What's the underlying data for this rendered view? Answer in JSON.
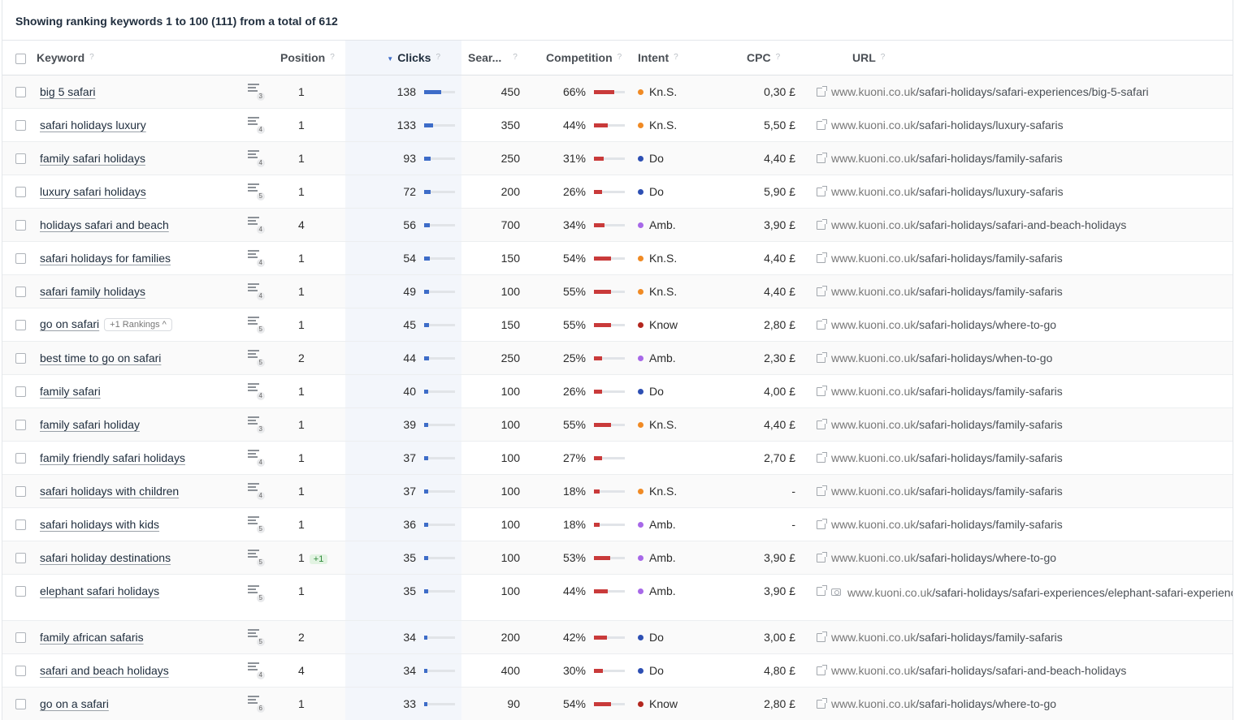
{
  "summary": {
    "prefix": "Showing ranking keywords 1 to 100 (111) from a total of",
    "total": "612"
  },
  "help_glyph": "?",
  "columns": {
    "keyword": "Keyword",
    "position": "Position",
    "clicks": "Clicks",
    "search": "Sear...",
    "competition": "Competition",
    "intent": "Intent",
    "cpc": "CPC",
    "url": "URL"
  },
  "colors": {
    "intent_orange": "#f08a24",
    "intent_blue": "#2d4fb3",
    "intent_purple": "#a768e8",
    "intent_red": "#b3261e",
    "click_bar": "#3d6cc8",
    "competition_bar": "#c93a3a"
  },
  "icons": {
    "serp": "serp-features-icon",
    "external": "external-link-icon",
    "camera": "screenshot-icon",
    "eye": "eye-icon",
    "chart": "chart-icon"
  },
  "rows": [
    {
      "keyword": "big 5 safari",
      "serp": "3",
      "position": "1",
      "clicks": "138",
      "clicks_frac": 0.55,
      "search": "450",
      "competition": "66%",
      "competition_frac": 0.66,
      "intent": "Kn.S.",
      "intent_color": "#f08a24",
      "cpc": "0,30 £",
      "domain": "www.kuoni.co.uk",
      "path": "/safari-holidays/safari-experiences/big-5-safari"
    },
    {
      "keyword": "safari holidays luxury",
      "serp": "4",
      "position": "1",
      "clicks": "133",
      "clicks_frac": 0.3,
      "search": "350",
      "competition": "44%",
      "competition_frac": 0.44,
      "intent": "Kn.S.",
      "intent_color": "#f08a24",
      "cpc": "5,50 £",
      "domain": "www.kuoni.co.uk",
      "path": "/safari-holidays/luxury-safaris"
    },
    {
      "keyword": "family safari holidays",
      "serp": "4",
      "position": "1",
      "clicks": "93",
      "clicks_frac": 0.22,
      "search": "250",
      "competition": "31%",
      "competition_frac": 0.31,
      "intent": "Do",
      "intent_color": "#2d4fb3",
      "cpc": "4,40 £",
      "domain": "www.kuoni.co.uk",
      "path": "/safari-holidays/family-safaris"
    },
    {
      "keyword": "luxury safari holidays",
      "serp": "5",
      "position": "1",
      "clicks": "72",
      "clicks_frac": 0.2,
      "search": "200",
      "competition": "26%",
      "competition_frac": 0.26,
      "intent": "Do",
      "intent_color": "#2d4fb3",
      "cpc": "5,90 £",
      "domain": "www.kuoni.co.uk",
      "path": "/safari-holidays/luxury-safaris"
    },
    {
      "keyword": "holidays safari and beach",
      "serp": "4",
      "position": "4",
      "clicks": "56",
      "clicks_frac": 0.18,
      "search": "700",
      "competition": "34%",
      "competition_frac": 0.34,
      "intent": "Amb.",
      "intent_color": "#a768e8",
      "cpc": "3,90 £",
      "domain": "www.kuoni.co.uk",
      "path": "/safari-holidays/safari-and-beach-holidays"
    },
    {
      "keyword": "safari holidays for families",
      "serp": "4",
      "position": "1",
      "clicks": "54",
      "clicks_frac": 0.18,
      "search": "150",
      "competition": "54%",
      "competition_frac": 0.54,
      "intent": "Kn.S.",
      "intent_color": "#f08a24",
      "cpc": "4,40 £",
      "domain": "www.kuoni.co.uk",
      "path": "/safari-holidays/family-safaris"
    },
    {
      "keyword": "safari family holidays",
      "serp": "4",
      "position": "1",
      "clicks": "49",
      "clicks_frac": 0.16,
      "search": "100",
      "competition": "55%",
      "competition_frac": 0.55,
      "intent": "Kn.S.",
      "intent_color": "#f08a24",
      "cpc": "4,40 £",
      "domain": "www.kuoni.co.uk",
      "path": "/safari-holidays/family-safaris"
    },
    {
      "keyword": "go on safari",
      "pill": "+1 Rankings ^",
      "serp": "5",
      "position": "1",
      "clicks": "45",
      "clicks_frac": 0.15,
      "search": "150",
      "competition": "55%",
      "competition_frac": 0.55,
      "intent": "Know",
      "intent_color": "#b3261e",
      "cpc": "2,80 £",
      "domain": "www.kuoni.co.uk",
      "path": "/safari-holidays/where-to-go"
    },
    {
      "keyword": "best time to go on safari",
      "serp": "5",
      "position": "2",
      "clicks": "44",
      "clicks_frac": 0.15,
      "search": "250",
      "competition": "25%",
      "competition_frac": 0.25,
      "intent": "Amb.",
      "intent_color": "#a768e8",
      "cpc": "2,30 £",
      "domain": "www.kuoni.co.uk",
      "path": "/safari-holidays/when-to-go"
    },
    {
      "keyword": "family safari",
      "serp": "4",
      "position": "1",
      "clicks": "40",
      "clicks_frac": 0.13,
      "search": "100",
      "competition": "26%",
      "competition_frac": 0.26,
      "intent": "Do",
      "intent_color": "#2d4fb3",
      "cpc": "4,00 £",
      "domain": "www.kuoni.co.uk",
      "path": "/safari-holidays/family-safaris"
    },
    {
      "keyword": "family safari holiday",
      "serp": "3",
      "position": "1",
      "clicks": "39",
      "clicks_frac": 0.13,
      "search": "100",
      "competition": "55%",
      "competition_frac": 0.55,
      "intent": "Kn.S.",
      "intent_color": "#f08a24",
      "cpc": "4,40 £",
      "domain": "www.kuoni.co.uk",
      "path": "/safari-holidays/family-safaris"
    },
    {
      "keyword": "family friendly safari holidays",
      "serp": "4",
      "position": "1",
      "clicks": "37",
      "clicks_frac": 0.12,
      "search": "100",
      "competition": "27%",
      "competition_frac": 0.27,
      "intent": "",
      "intent_color": "",
      "cpc": "2,70 £",
      "domain": "www.kuoni.co.uk",
      "path": "/safari-holidays/family-safaris"
    },
    {
      "keyword": "safari holidays with children",
      "serp": "4",
      "position": "1",
      "clicks": "37",
      "clicks_frac": 0.12,
      "search": "100",
      "competition": "18%",
      "competition_frac": 0.18,
      "intent": "Kn.S.",
      "intent_color": "#f08a24",
      "cpc": "-",
      "domain": "www.kuoni.co.uk",
      "path": "/safari-holidays/family-safaris"
    },
    {
      "keyword": "safari holidays with kids",
      "serp": "5",
      "position": "1",
      "clicks": "36",
      "clicks_frac": 0.12,
      "search": "100",
      "competition": "18%",
      "competition_frac": 0.18,
      "intent": "Amb.",
      "intent_color": "#a768e8",
      "cpc": "-",
      "domain": "www.kuoni.co.uk",
      "path": "/safari-holidays/family-safaris"
    },
    {
      "keyword": "safari holiday destinations",
      "serp": "5",
      "position": "1",
      "position_change": "+1",
      "clicks": "35",
      "clicks_frac": 0.12,
      "search": "100",
      "competition": "53%",
      "competition_frac": 0.53,
      "intent": "Amb.",
      "intent_color": "#a768e8",
      "cpc": "3,90 £",
      "domain": "www.kuoni.co.uk",
      "path": "/safari-holidays/where-to-go"
    },
    {
      "keyword": "elephant safari holidays",
      "serp": "5",
      "position": "1",
      "clicks": "35",
      "clicks_frac": 0.12,
      "search": "100",
      "competition": "44%",
      "competition_frac": 0.44,
      "intent": "Amb.",
      "intent_color": "#a768e8",
      "cpc": "3,90 £",
      "domain": "www.kuoni.co.uk",
      "path": "/safari-holidays/safari-experiences/elephant-safari-experiences",
      "screenshot": true
    },
    {
      "keyword": "family african safaris",
      "serp": "5",
      "position": "2",
      "clicks": "34",
      "clicks_frac": 0.11,
      "search": "200",
      "competition": "42%",
      "competition_frac": 0.42,
      "intent": "Do",
      "intent_color": "#2d4fb3",
      "cpc": "3,00 £",
      "domain": "www.kuoni.co.uk",
      "path": "/safari-holidays/family-safaris"
    },
    {
      "keyword": "safari and beach holidays",
      "serp": "4",
      "position": "4",
      "clicks": "34",
      "clicks_frac": 0.11,
      "search": "400",
      "competition": "30%",
      "competition_frac": 0.3,
      "intent": "Do",
      "intent_color": "#2d4fb3",
      "cpc": "4,80 £",
      "domain": "www.kuoni.co.uk",
      "path": "/safari-holidays/safari-and-beach-holidays"
    },
    {
      "keyword": "go on a safari",
      "serp": "6",
      "position": "1",
      "clicks": "33",
      "clicks_frac": 0.11,
      "search": "90",
      "competition": "54%",
      "competition_frac": 0.54,
      "intent": "Know",
      "intent_color": "#b3261e",
      "cpc": "2,80 £",
      "domain": "www.kuoni.co.uk",
      "path": "/safari-holidays/where-to-go"
    }
  ]
}
